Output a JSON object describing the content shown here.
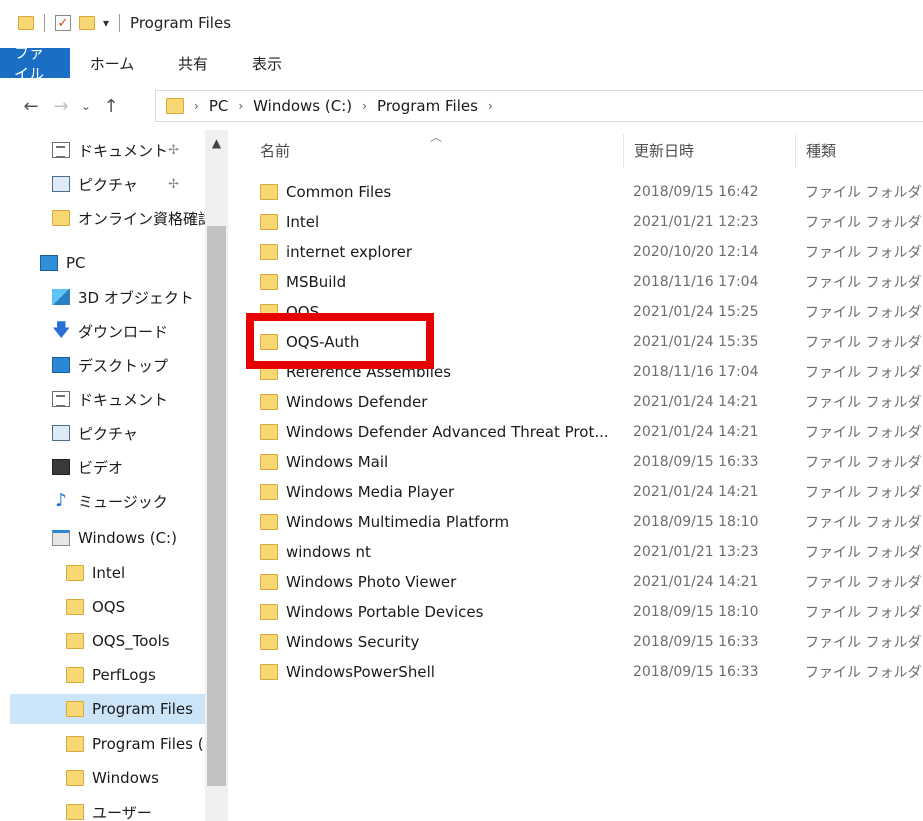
{
  "title_bar": {
    "title": "Program Files",
    "qa_dropdown": "▾"
  },
  "ribbon": {
    "tabs": [
      "ファイル",
      "ホーム",
      "共有",
      "表示"
    ]
  },
  "nav": {
    "back": "←",
    "forward": "→",
    "recent": "⌄",
    "up": "↑",
    "breadcrumb": [
      "PC",
      "Windows (C:)",
      "Program Files"
    ],
    "separator": "›"
  },
  "sidebar": {
    "items": [
      {
        "label": "ドキュメント",
        "icon": "document-icon",
        "pinned": true
      },
      {
        "label": "ピクチャ",
        "icon": "pictures-icon",
        "pinned": true
      },
      {
        "label": "オンライン資格確認",
        "icon": "folder-icon",
        "pinned": false
      },
      {
        "label": "PC",
        "icon": "pc-icon"
      },
      {
        "label": "3D オブジェクト",
        "icon": "3d-objects-icon"
      },
      {
        "label": "ダウンロード",
        "icon": "download-icon"
      },
      {
        "label": "デスクトップ",
        "icon": "desktop-icon"
      },
      {
        "label": "ドキュメント",
        "icon": "document-icon"
      },
      {
        "label": "ピクチャ",
        "icon": "pictures-icon"
      },
      {
        "label": "ビデオ",
        "icon": "video-icon"
      },
      {
        "label": "ミュージック",
        "icon": "music-icon"
      },
      {
        "label": "Windows (C:)",
        "icon": "drive-icon"
      },
      {
        "label": "Intel",
        "icon": "folder-icon"
      },
      {
        "label": "OQS",
        "icon": "folder-icon"
      },
      {
        "label": "OQS_Tools",
        "icon": "folder-icon"
      },
      {
        "label": "PerfLogs",
        "icon": "folder-icon"
      },
      {
        "label": "Program Files",
        "icon": "folder-icon",
        "selected": true
      },
      {
        "label": "Program Files (",
        "icon": "folder-icon"
      },
      {
        "label": "Windows",
        "icon": "folder-icon"
      },
      {
        "label": "ユーザー",
        "icon": "folder-icon"
      }
    ]
  },
  "columns": {
    "name": "名前",
    "modified": "更新日時",
    "type": "種類"
  },
  "files": [
    {
      "name": "Common Files",
      "modified": "2018/09/15 16:42",
      "type": "ファイル フォルダー"
    },
    {
      "name": "Intel",
      "modified": "2021/01/21 12:23",
      "type": "ファイル フォルダー"
    },
    {
      "name": "internet explorer",
      "modified": "2020/10/20 12:14",
      "type": "ファイル フォルダー"
    },
    {
      "name": "MSBuild",
      "modified": "2018/11/16 17:04",
      "type": "ファイル フォルダー"
    },
    {
      "name": "OQS",
      "modified": "2021/01/24 15:25",
      "type": "ファイル フォルダー"
    },
    {
      "name": "OQS-Auth",
      "modified": "2021/01/24 15:35",
      "type": "ファイル フォルダー"
    },
    {
      "name": "Reference Assemblies",
      "modified": "2018/11/16 17:04",
      "type": "ファイル フォルダー"
    },
    {
      "name": "Windows Defender",
      "modified": "2021/01/24 14:21",
      "type": "ファイル フォルダー"
    },
    {
      "name": "Windows Defender Advanced Threat Prot...",
      "modified": "2021/01/24 14:21",
      "type": "ファイル フォルダー"
    },
    {
      "name": "Windows Mail",
      "modified": "2018/09/15 16:33",
      "type": "ファイル フォルダー"
    },
    {
      "name": "Windows Media Player",
      "modified": "2021/01/24 14:21",
      "type": "ファイル フォルダー"
    },
    {
      "name": "Windows Multimedia Platform",
      "modified": "2018/09/15 18:10",
      "type": "ファイル フォルダー"
    },
    {
      "name": "windows nt",
      "modified": "2021/01/21 13:23",
      "type": "ファイル フォルダー"
    },
    {
      "name": "Windows Photo Viewer",
      "modified": "2021/01/24 14:21",
      "type": "ファイル フォルダー"
    },
    {
      "name": "Windows Portable Devices",
      "modified": "2018/09/15 18:10",
      "type": "ファイル フォルダー"
    },
    {
      "name": "Windows Security",
      "modified": "2018/09/15 16:33",
      "type": "ファイル フォルダー"
    },
    {
      "name": "WindowsPowerShell",
      "modified": "2018/09/15 16:33",
      "type": "ファイル フォルダー"
    }
  ],
  "colors": {
    "accent": "#1a6fc4",
    "folder": "#f8d775",
    "selection": "#cce4f7",
    "highlight": "#e60000"
  }
}
